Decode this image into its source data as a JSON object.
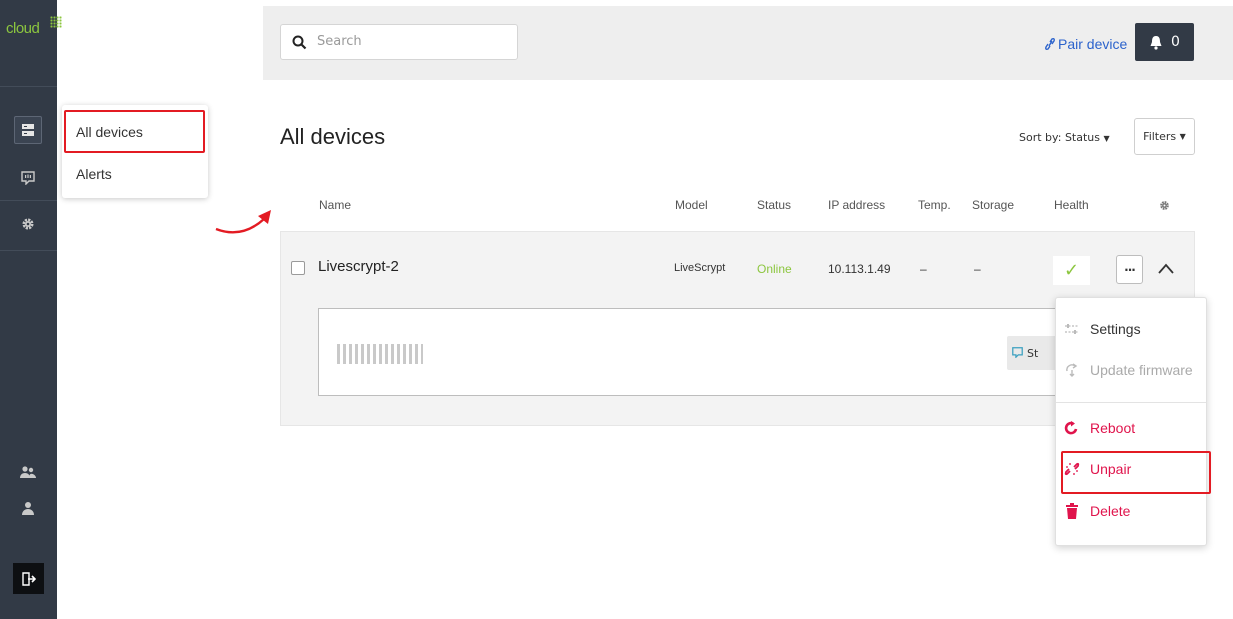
{
  "brand": {
    "logo_text": "cloud",
    "accent_color": "#8cc63f",
    "rail_color": "#323a46"
  },
  "rail": {
    "items": [
      {
        "icon": "devices-icon",
        "active": true
      },
      {
        "icon": "alerts-icon",
        "active": false
      },
      {
        "icon": "gear-icon",
        "active": false
      }
    ],
    "bottom": [
      {
        "icon": "users-icon"
      },
      {
        "icon": "user-icon"
      },
      {
        "icon": "logout-icon"
      }
    ]
  },
  "flyout": {
    "items": [
      "All devices",
      "Alerts"
    ]
  },
  "topbar": {
    "search_placeholder": "Search",
    "pair_label": "Pair device",
    "notification_count": "0"
  },
  "page": {
    "title": "All devices",
    "sort_label": "Sort by: Status",
    "filters_label": "Filters"
  },
  "table": {
    "columns": [
      "Name",
      "Model",
      "Status",
      "IP address",
      "Temp.",
      "Storage",
      "Health"
    ],
    "rows": [
      {
        "name": "Livescrypt-2",
        "model": "LiveScrypt",
        "status": "Online",
        "ip": "10.113.1.49",
        "temp": "–",
        "storage": "–",
        "health": "✓",
        "status_color": "#8cc63f"
      }
    ]
  },
  "detail": {
    "button_label": "St"
  },
  "dropdown": {
    "items": [
      {
        "label": "Settings",
        "icon": "settings-sliders-icon",
        "color": "#333333"
      },
      {
        "label": "Update firmware",
        "icon": "update-firmware-icon",
        "color": "#aaaaaa"
      },
      {
        "label": "Reboot",
        "icon": "reboot-icon",
        "color": "#e0144c"
      },
      {
        "label": "Unpair",
        "icon": "unlink-icon",
        "color": "#e0144c"
      },
      {
        "label": "Delete",
        "icon": "trash-icon",
        "color": "#e0144c"
      }
    ]
  },
  "annotation_color": "#e31b23"
}
